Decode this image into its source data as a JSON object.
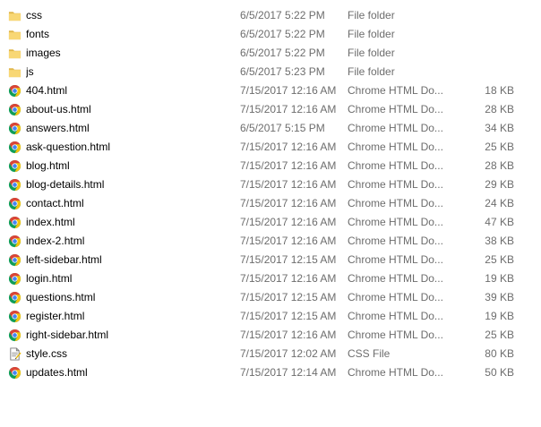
{
  "colors": {
    "folder_yellow": "#f8d775",
    "folder_dark": "#e0b64a",
    "chrome_red": "#db4437",
    "chrome_yellow": "#f4c20d",
    "chrome_green": "#0f9d58",
    "chrome_blue": "#4285f4",
    "secondary_text": "#6d6d6d"
  },
  "files": [
    {
      "name": "css",
      "date": "6/5/2017 5:22 PM",
      "type": "File folder",
      "size": "",
      "icon": "folder-icon"
    },
    {
      "name": "fonts",
      "date": "6/5/2017 5:22 PM",
      "type": "File folder",
      "size": "",
      "icon": "folder-icon"
    },
    {
      "name": "images",
      "date": "6/5/2017 5:22 PM",
      "type": "File folder",
      "size": "",
      "icon": "folder-icon"
    },
    {
      "name": "js",
      "date": "6/5/2017 5:23 PM",
      "type": "File folder",
      "size": "",
      "icon": "folder-icon"
    },
    {
      "name": "404.html",
      "date": "7/15/2017 12:16 AM",
      "type": "Chrome HTML Do...",
      "size": "18 KB",
      "icon": "chrome-html-icon"
    },
    {
      "name": "about-us.html",
      "date": "7/15/2017 12:16 AM",
      "type": "Chrome HTML Do...",
      "size": "28 KB",
      "icon": "chrome-html-icon"
    },
    {
      "name": "answers.html",
      "date": "6/5/2017 5:15 PM",
      "type": "Chrome HTML Do...",
      "size": "34 KB",
      "icon": "chrome-html-icon"
    },
    {
      "name": "ask-question.html",
      "date": "7/15/2017 12:16 AM",
      "type": "Chrome HTML Do...",
      "size": "25 KB",
      "icon": "chrome-html-icon"
    },
    {
      "name": "blog.html",
      "date": "7/15/2017 12:16 AM",
      "type": "Chrome HTML Do...",
      "size": "28 KB",
      "icon": "chrome-html-icon"
    },
    {
      "name": "blog-details.html",
      "date": "7/15/2017 12:16 AM",
      "type": "Chrome HTML Do...",
      "size": "29 KB",
      "icon": "chrome-html-icon"
    },
    {
      "name": "contact.html",
      "date": "7/15/2017 12:16 AM",
      "type": "Chrome HTML Do...",
      "size": "24 KB",
      "icon": "chrome-html-icon"
    },
    {
      "name": "index.html",
      "date": "7/15/2017 12:16 AM",
      "type": "Chrome HTML Do...",
      "size": "47 KB",
      "icon": "chrome-html-icon"
    },
    {
      "name": "index-2.html",
      "date": "7/15/2017 12:16 AM",
      "type": "Chrome HTML Do...",
      "size": "38 KB",
      "icon": "chrome-html-icon"
    },
    {
      "name": "left-sidebar.html",
      "date": "7/15/2017 12:15 AM",
      "type": "Chrome HTML Do...",
      "size": "25 KB",
      "icon": "chrome-html-icon"
    },
    {
      "name": "login.html",
      "date": "7/15/2017 12:16 AM",
      "type": "Chrome HTML Do...",
      "size": "19 KB",
      "icon": "chrome-html-icon"
    },
    {
      "name": "questions.html",
      "date": "7/15/2017 12:15 AM",
      "type": "Chrome HTML Do...",
      "size": "39 KB",
      "icon": "chrome-html-icon"
    },
    {
      "name": "register.html",
      "date": "7/15/2017 12:15 AM",
      "type": "Chrome HTML Do...",
      "size": "19 KB",
      "icon": "chrome-html-icon"
    },
    {
      "name": "right-sidebar.html",
      "date": "7/15/2017 12:16 AM",
      "type": "Chrome HTML Do...",
      "size": "25 KB",
      "icon": "chrome-html-icon"
    },
    {
      "name": "style.css",
      "date": "7/15/2017 12:02 AM",
      "type": "CSS File",
      "size": "80 KB",
      "icon": "css-file-icon"
    },
    {
      "name": "updates.html",
      "date": "7/15/2017 12:14 AM",
      "type": "Chrome HTML Do...",
      "size": "50 KB",
      "icon": "chrome-html-icon"
    }
  ]
}
